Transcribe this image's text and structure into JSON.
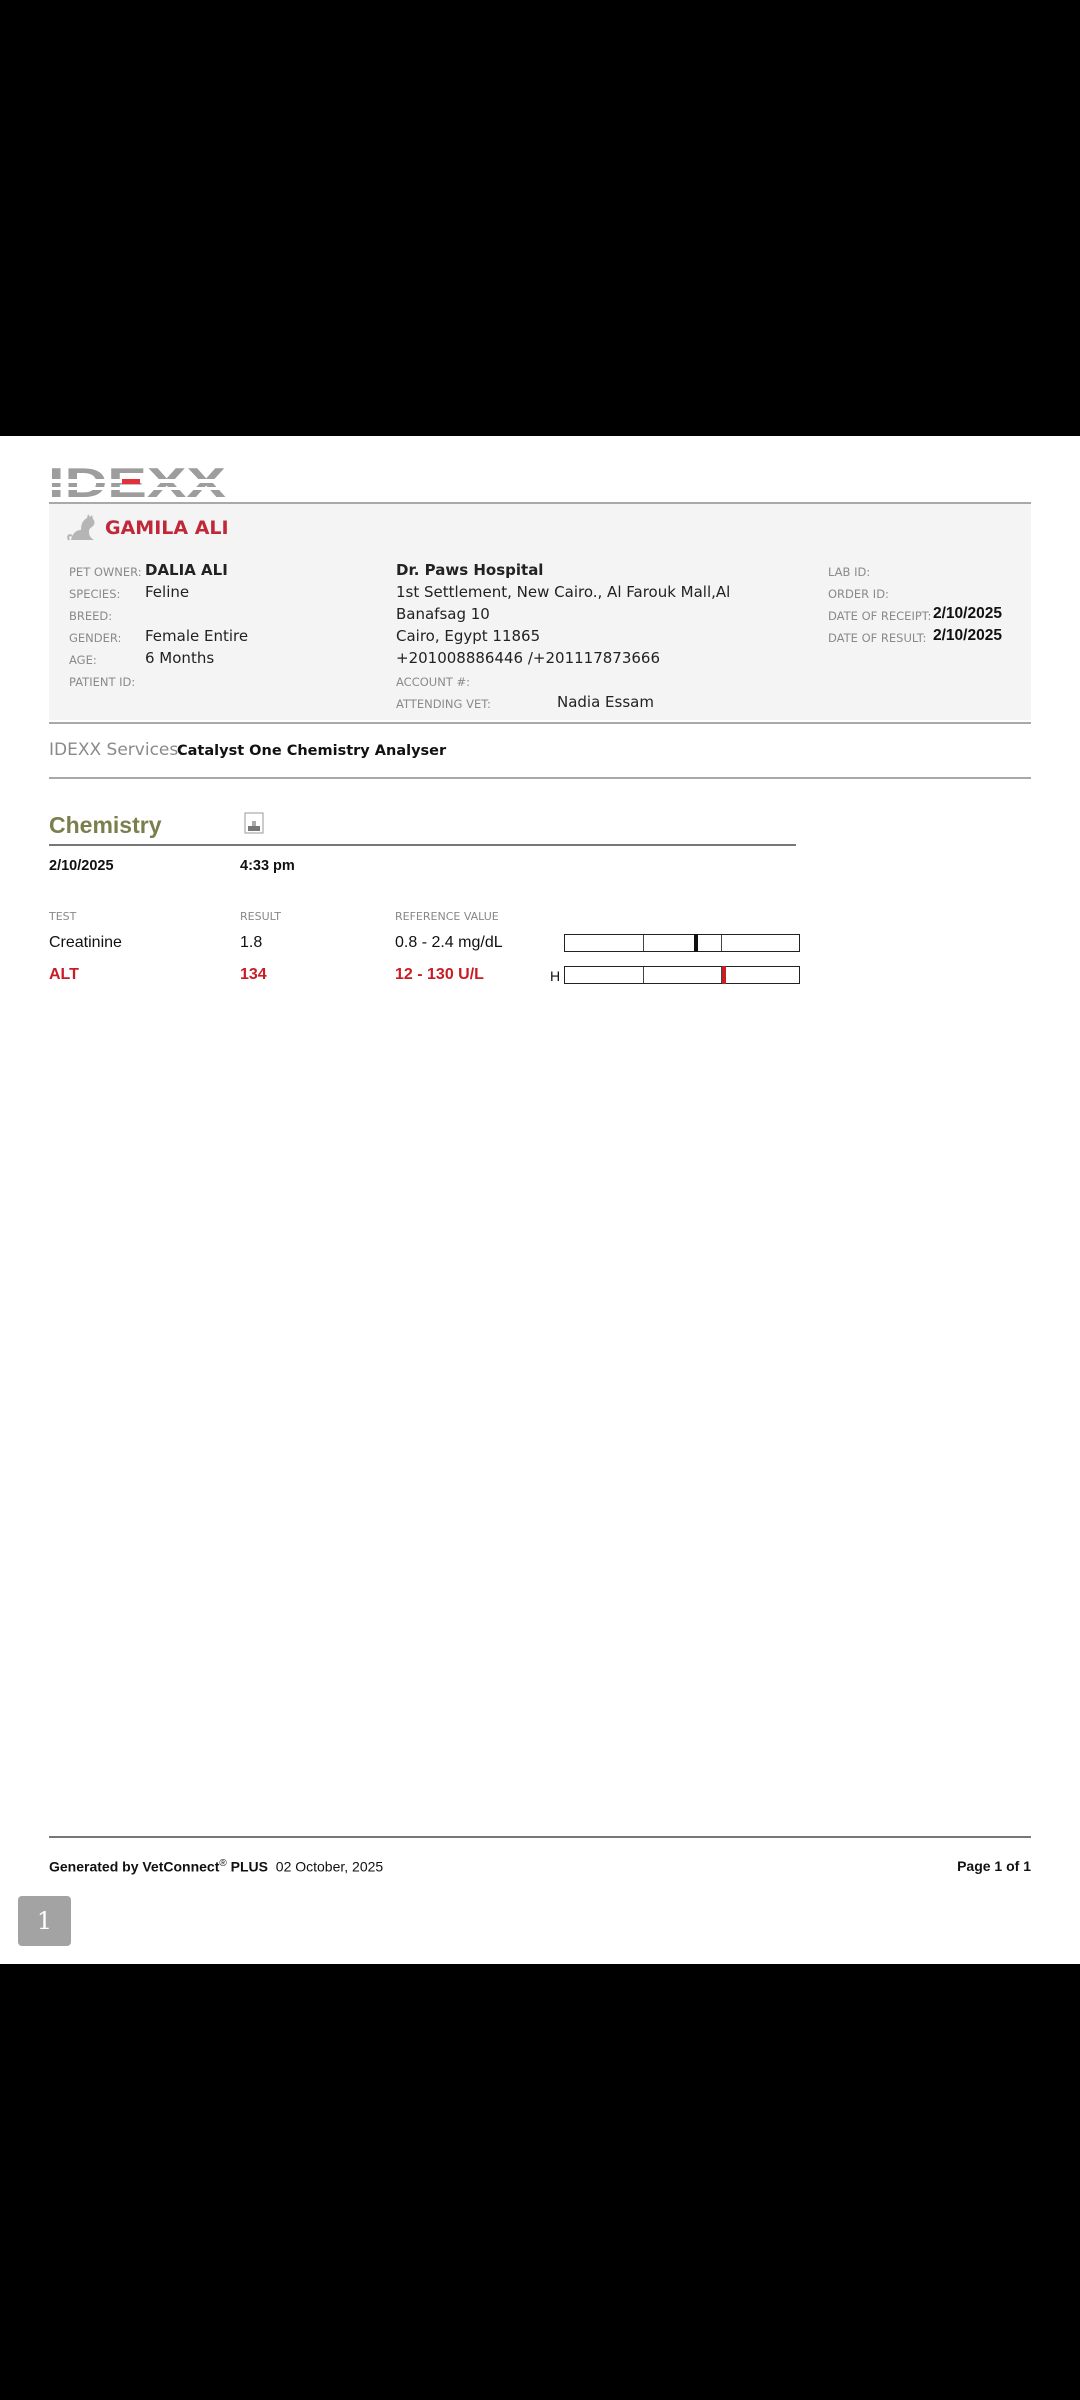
{
  "header": {
    "logo_text": "IDEXX"
  },
  "patient": {
    "name": "GAMILA ALI",
    "fields_left": [
      {
        "label": "PET OWNER:",
        "value": "DALIA ALI"
      },
      {
        "label": "SPECIES:",
        "value": "Feline"
      },
      {
        "label": "BREED:",
        "value": ""
      },
      {
        "label": "GENDER:",
        "value": "Female Entire"
      },
      {
        "label": "AGE:",
        "value": "6 Months"
      },
      {
        "label": "PATIENT ID:",
        "value": ""
      }
    ],
    "clinic": {
      "name": "Dr. Paws Hospital",
      "address_line1": "1st Settlement, New Cairo., Al Farouk Mall,Al",
      "address_line2": "Banafsag 10",
      "address_line3": "Cairo, Egypt 11865",
      "phone": "+201008886446 /+201117873666",
      "account_label": "ACCOUNT #:",
      "account_value": "",
      "vet_label": "ATTENDING VET:",
      "vet_value": "Nadia Essam"
    },
    "fields_right": [
      {
        "label": "LAB ID:",
        "value": ""
      },
      {
        "label": "ORDER ID:",
        "value": ""
      },
      {
        "label": "DATE OF RECEIPT:",
        "value": "2/10/2025"
      },
      {
        "label": "DATE OF RESULT:",
        "value": "2/10/2025"
      }
    ]
  },
  "services": {
    "label": "IDEXX Services:",
    "value": "Catalyst One Chemistry Analyser"
  },
  "chemistry": {
    "title": "Chemistry",
    "date": "2/10/2025",
    "time": "4:33 pm",
    "columns": {
      "test": "TEST",
      "result": "RESULT",
      "reference": "REFERENCE VALUE"
    },
    "rows": [
      {
        "test": "Creatinine",
        "result": "1.8",
        "reference": "0.8 - 2.4 mg/dL",
        "flag": "",
        "marker_position": 0.55,
        "marker_color": "#111111",
        "high": false
      },
      {
        "test": "ALT",
        "result": "134",
        "reference": "12 - 130 U/L",
        "flag": "H",
        "marker_position": 0.67,
        "marker_color": "#c81d25",
        "high": true
      }
    ]
  },
  "footer": {
    "generated_by": "Generated by VetConnect",
    "registered": "®",
    "plus": "PLUS",
    "date": "02 October, 2025",
    "page": "Page 1 of 1"
  },
  "viewer": {
    "page_number": "1"
  },
  "colors": {
    "patient_name": "#c0283a",
    "section_title": "#7a7f4c",
    "high_value": "#c81d25"
  }
}
